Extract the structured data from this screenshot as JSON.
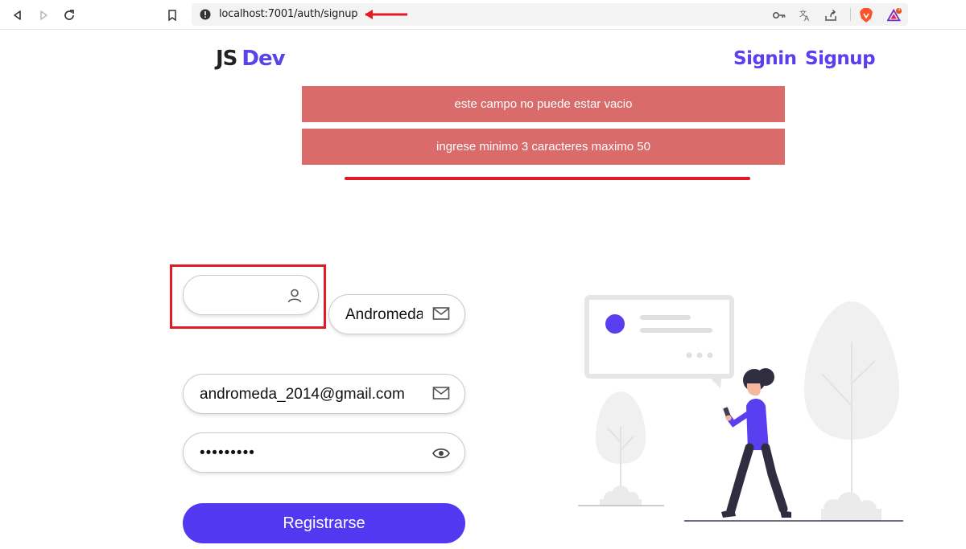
{
  "browser": {
    "url": "localhost:7001/auth/signup",
    "icons": [
      "back-icon",
      "forward-icon",
      "reload-icon",
      "bookmark-icon",
      "info-icon",
      "key-icon",
      "translate-icon",
      "share-icon",
      "brave-icon",
      "rewards-icon"
    ],
    "badge_count": "1"
  },
  "header": {
    "logo_js": "JS",
    "logo_dev": "Dev",
    "nav": {
      "signin": "Signin",
      "signup": "Signup"
    }
  },
  "alerts": [
    {
      "text": "este campo no puede estar vacio"
    },
    {
      "text": "ingrese minimo 3 caracteres maximo 50"
    }
  ],
  "form": {
    "username": {
      "value": "",
      "icon": "user-icon"
    },
    "name": {
      "value": "Andromeda",
      "icon": "mail-icon"
    },
    "email": {
      "value": "andromeda_2014@gmail.com",
      "icon": "mail-icon"
    },
    "password": {
      "value": "•••••••••",
      "icon": "eye-icon"
    },
    "submit_label": "Registrarse"
  },
  "colors": {
    "accent": "#5238f0",
    "alert_bg": "#d96b6b",
    "annotation_red": "#e01b24"
  }
}
